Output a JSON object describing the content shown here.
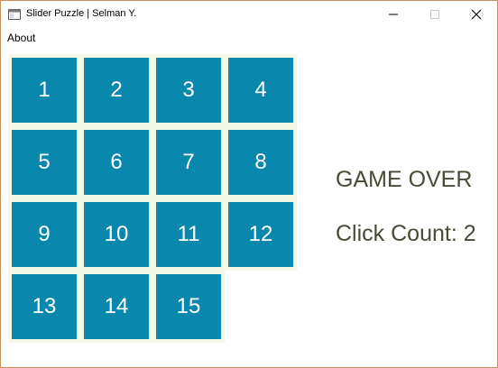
{
  "window": {
    "title": "Slider Puzzle | Selman Y."
  },
  "menu": {
    "items": [
      "About"
    ]
  },
  "board": {
    "tiles": [
      "1",
      "2",
      "3",
      "4",
      "5",
      "6",
      "7",
      "8",
      "9",
      "10",
      "11",
      "12",
      "13",
      "14",
      "15"
    ],
    "tile_color": "#0a87ad",
    "tile_border_color": "#f3f8e8",
    "text_color": "#ffffff"
  },
  "status": {
    "title": "GAME OVER",
    "click_count": "Click Count: 2",
    "text_color": "#4a4a38"
  }
}
